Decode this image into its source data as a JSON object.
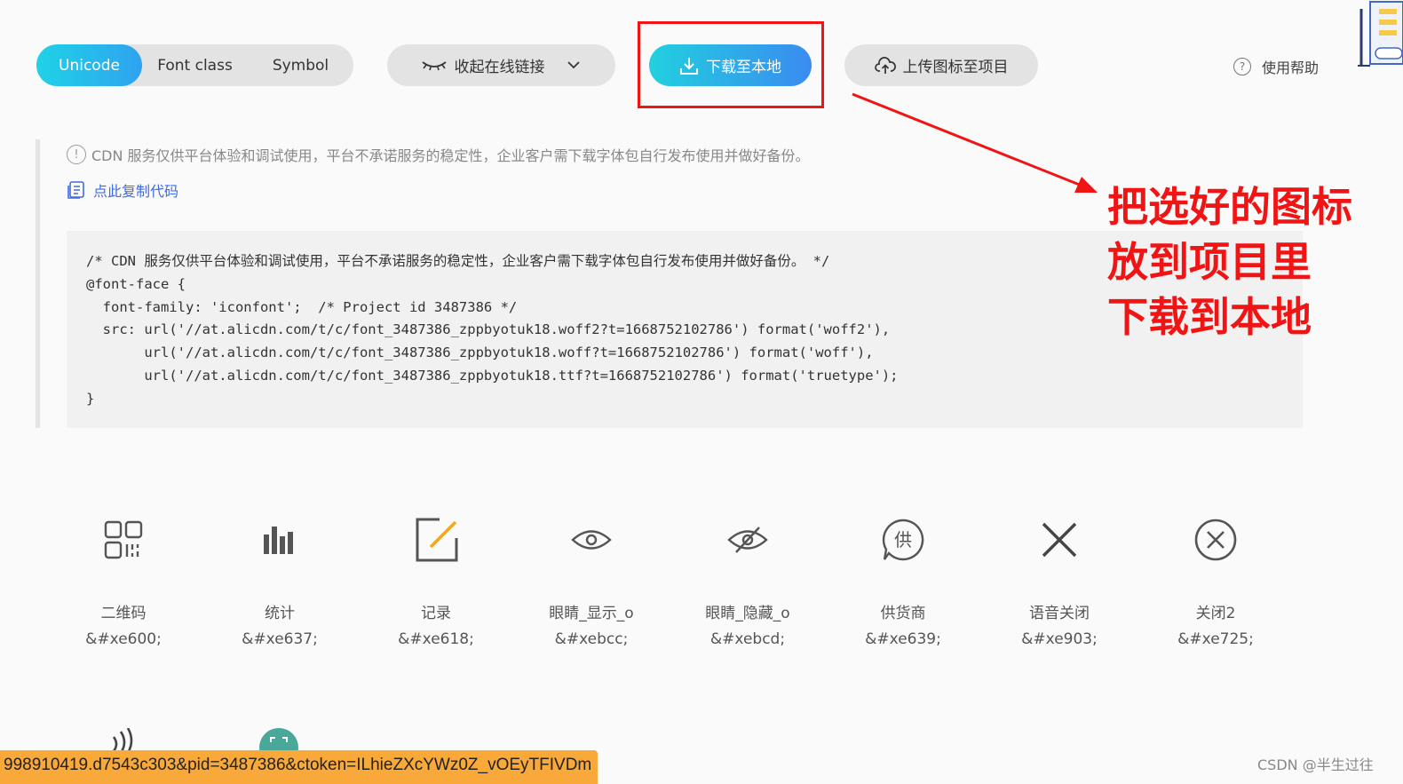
{
  "toolbar": {
    "tabs": [
      {
        "label": "Unicode",
        "active": true
      },
      {
        "label": "Font class",
        "active": false
      },
      {
        "label": "Symbol",
        "active": false
      }
    ],
    "collapse_label": "收起在线链接",
    "download_label": "下载至本地",
    "upload_label": "上传图标至项目",
    "help_label": "使用帮助"
  },
  "notice": {
    "text": "CDN 服务仅供平台体验和调试使用，平台不承诺服务的稳定性，企业客户需下载字体包自行发布使用并做好备份。",
    "copy_label": "点此复制代码"
  },
  "code": "/* CDN 服务仅供平台体验和调试使用，平台不承诺服务的稳定性，企业客户需下载字体包自行发布使用并做好备份。 */\n@font-face {\n  font-family: 'iconfont';  /* Project id 3487386 */\n  src: url('//at.alicdn.com/t/c/font_3487386_zppbyotuk18.woff2?t=1668752102786') format('woff2'),\n       url('//at.alicdn.com/t/c/font_3487386_zppbyotuk18.woff?t=1668752102786') format('woff'),\n       url('//at.alicdn.com/t/c/font_3487386_zppbyotuk18.ttf?t=1668752102786') format('truetype');\n}",
  "annotation": {
    "line1": "把选好的图标",
    "line2": "放到项目里",
    "line3": "下载到本地",
    "color": "#f01414"
  },
  "icons": [
    {
      "name": "二维码",
      "code": "&#xe600;",
      "icon": "qrcode-icon"
    },
    {
      "name": "统计",
      "code": "&#xe637;",
      "icon": "stats-icon"
    },
    {
      "name": "记录",
      "code": "&#xe618;",
      "icon": "record-icon"
    },
    {
      "name": "眼睛_显示_o",
      "code": "&#xebcc;",
      "icon": "eye-show-icon"
    },
    {
      "name": "眼睛_隐藏_o",
      "code": "&#xebcd;",
      "icon": "eye-hide-icon"
    },
    {
      "name": "供货商",
      "code": "&#xe639;",
      "icon": "supplier-icon"
    },
    {
      "name": "语音关闭",
      "code": "&#xe903;",
      "icon": "voice-close-icon"
    },
    {
      "name": "关闭2",
      "code": "&#xe725;",
      "icon": "close-circle-icon"
    }
  ],
  "status_url": "998910419.d7543c303&pid=3487386&ctoken=ILhieZXcYWz0Z_vOEyTFIVDm",
  "watermark": "CSDN @半生过往"
}
